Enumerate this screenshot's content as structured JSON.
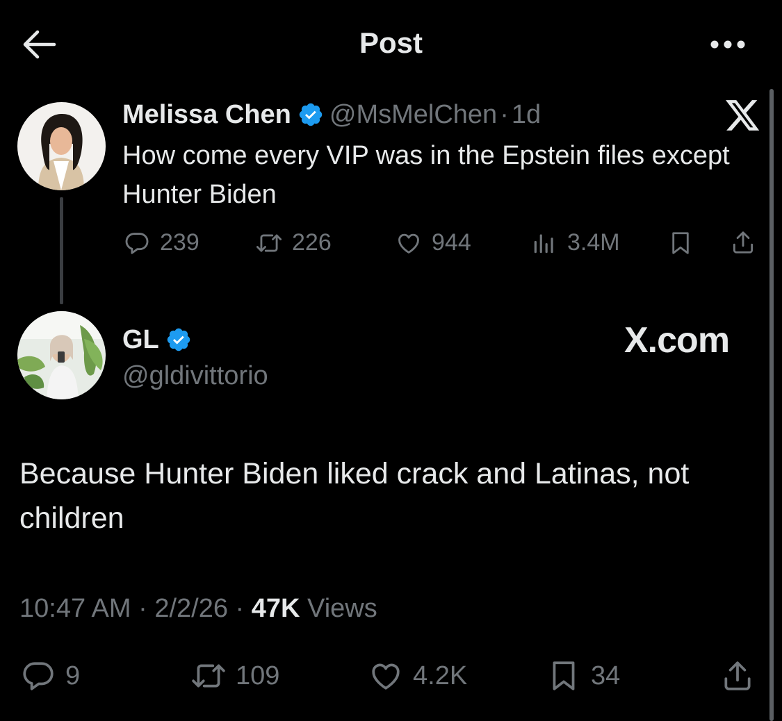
{
  "header": {
    "title": "Post",
    "back_icon": "arrow-left-icon",
    "more_icon": "ellipsis-icon"
  },
  "quoted_tweet": {
    "name": "Melissa Chen",
    "handle": "@MsMelChen",
    "separator": "·",
    "time": "1d",
    "text": "How come every VIP was in the Epstein files except Hunter Biden",
    "replies": "239",
    "retweets": "226",
    "likes": "944",
    "views": "3.4M"
  },
  "main_tweet": {
    "name": "GL",
    "handle": "@gldivittorio",
    "watermark": "X.com",
    "text": "Because Hunter Biden liked crack and Latinas, not children",
    "time": "10:47 AM",
    "sep1": " · ",
    "date": "2/2/26",
    "sep2": " · ",
    "views_count": "47K",
    "views_label": " Views",
    "replies": "9",
    "retweets": "109",
    "likes": "4.2K",
    "bookmarks": "34"
  },
  "colors": {
    "background": "#000000",
    "text": "#e7e9ea",
    "secondary": "#71767b",
    "verified_badge": "#1d9bf0"
  }
}
